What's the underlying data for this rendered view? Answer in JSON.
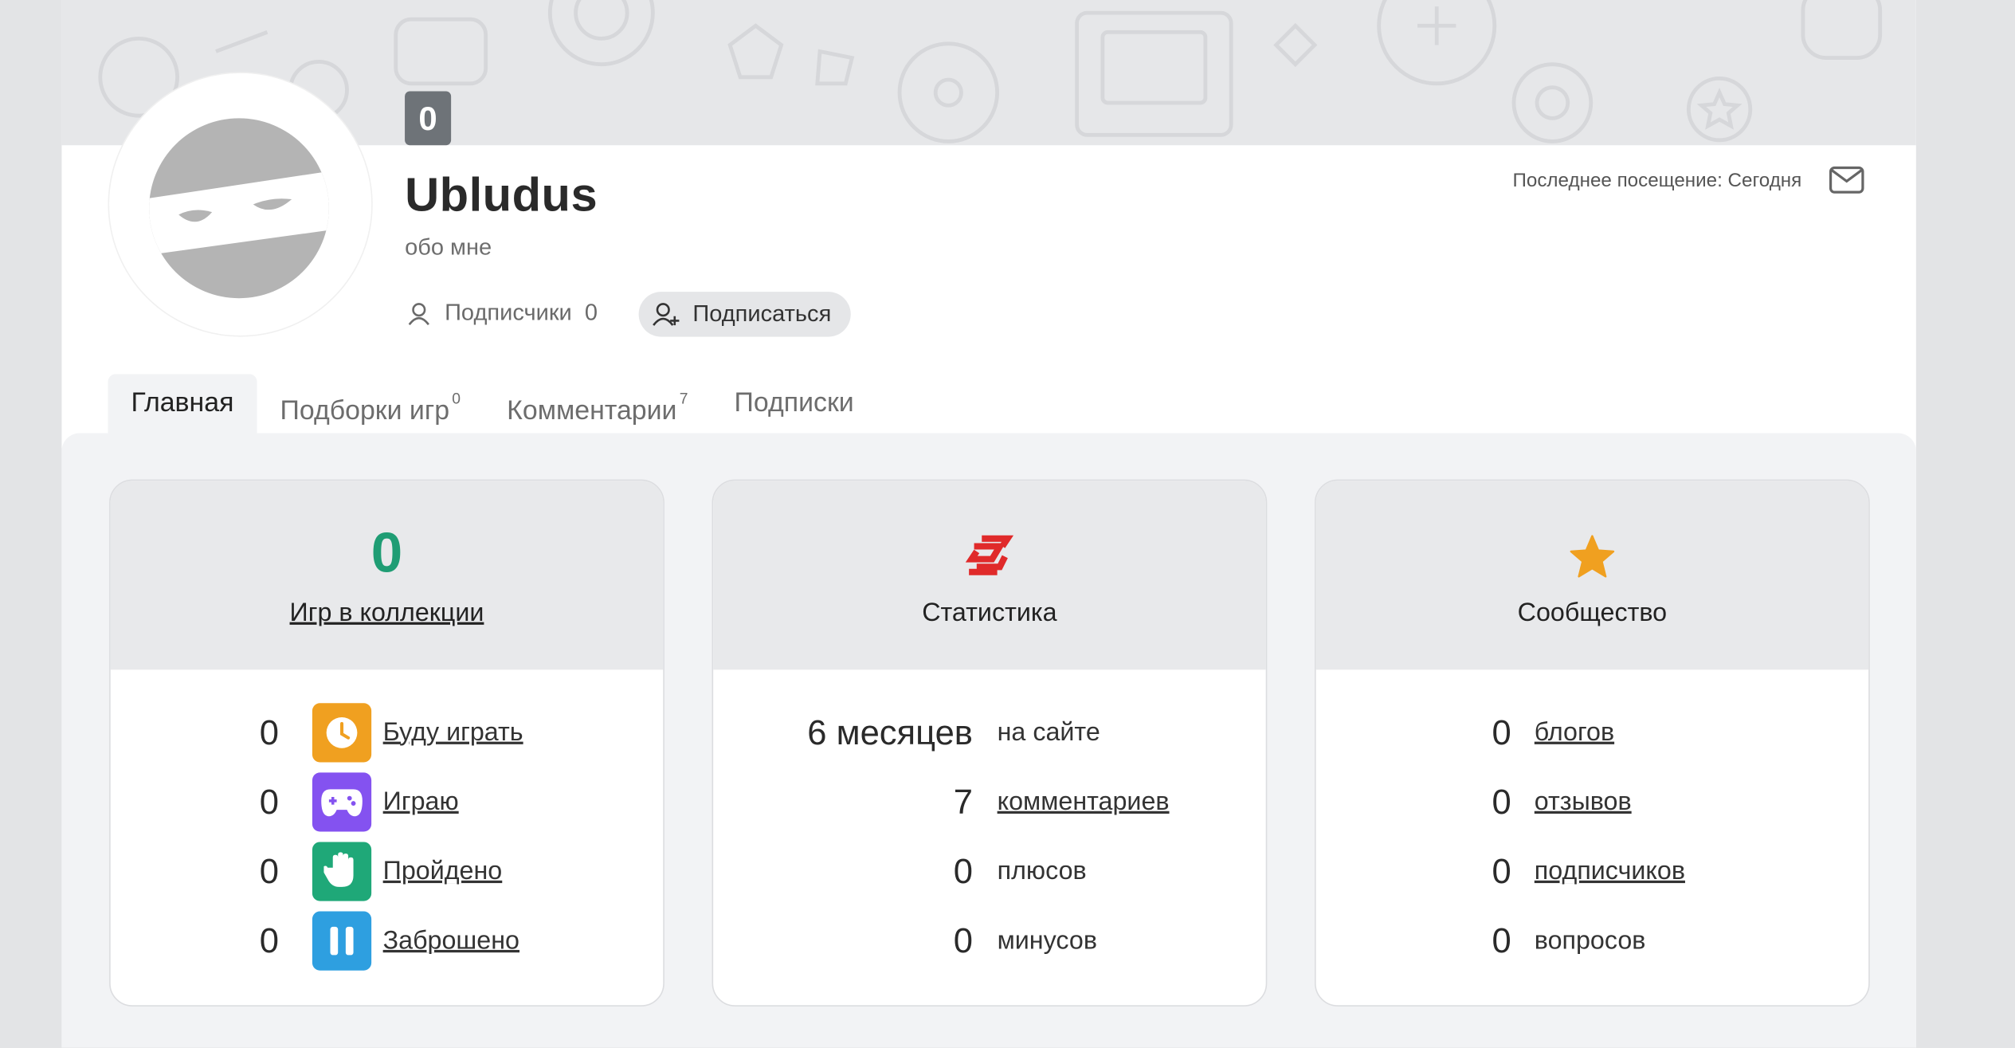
{
  "profile": {
    "level": "0",
    "username": "Ubludus",
    "about": "обо мне",
    "followers_label": "Подписчики",
    "followers_count": "0",
    "follow_button": "Подписаться",
    "last_visit": "Последнее посещение: Сегодня"
  },
  "tabs": [
    {
      "label": "Главная",
      "sup": ""
    },
    {
      "label": "Подборки игр",
      "sup": "0"
    },
    {
      "label": "Комментарии",
      "sup": "7"
    },
    {
      "label": "Подписки",
      "sup": ""
    }
  ],
  "collection": {
    "count": "0",
    "title": "Игр в коллекции",
    "rows": [
      {
        "value": "0",
        "label": "Буду играть",
        "icon": "clock-icon",
        "color": "#f0a020"
      },
      {
        "value": "0",
        "label": "Играю",
        "icon": "gamepad-icon",
        "color": "#8452f0"
      },
      {
        "value": "0",
        "label": "Пройдено",
        "icon": "hand-icon",
        "color": "#1fa878"
      },
      {
        "value": "0",
        "label": "Заброшено",
        "icon": "pause-icon",
        "color": "#2e9fe0"
      }
    ]
  },
  "stats": {
    "title": "Статистика",
    "icon_color": "#e02a2a",
    "rows": [
      {
        "value": "6 месяцев",
        "label": "на сайте",
        "link": false
      },
      {
        "value": "7",
        "label": "комментариев",
        "link": true
      },
      {
        "value": "0",
        "label": "плюсов",
        "link": false
      },
      {
        "value": "0",
        "label": "минусов",
        "link": false
      }
    ]
  },
  "community": {
    "title": "Сообщество",
    "icon_color": "#f0a020",
    "rows": [
      {
        "value": "0",
        "label": "блогов",
        "link": true
      },
      {
        "value": "0",
        "label": "отзывов",
        "link": true
      },
      {
        "value": "0",
        "label": "подписчиков",
        "link": true
      },
      {
        "value": "0",
        "label": "вопросов",
        "link": false
      }
    ]
  }
}
